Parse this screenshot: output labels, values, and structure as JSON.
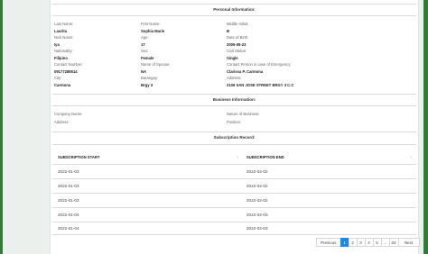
{
  "personal": {
    "title": "Personal Information:",
    "rows": [
      {
        "c1_label": "Last Name:",
        "c2_label": "First Name:",
        "c3_label": "Middle Initial:",
        "c1_value": "Laurita",
        "c2_value": "Sophia Marie",
        "c3_value": "B"
      },
      {
        "c1_label": "Nick Name:",
        "c2_label": "Age:",
        "c3_label": "Date of Birth:",
        "c1_value": "Iya",
        "c2_value": "17",
        "c3_value": "2005-05-23"
      },
      {
        "c1_label": "Nationality:",
        "c2_label": "Sex:",
        "c3_label": "Civil Status:",
        "c1_value": "Filipino",
        "c2_value": "Female",
        "c3_value": "Single"
      },
      {
        "c1_label": "Contact Number:",
        "c2_label": "Name of Spouse:",
        "c3_label": "Contact Person in case of Emergency:",
        "c1_value": "09177285514",
        "c2_value": "NA",
        "c3_value": "Clarissa P. Carmona"
      },
      {
        "c1_label": "City:",
        "c2_label": "Barangay:",
        "c3_label": "Address:",
        "c1_value": "Carmona",
        "c2_value": "Brgy 3",
        "c3_value": "2106 SAN JOSE STREET BRGY 3 C.C"
      }
    ]
  },
  "business": {
    "title": "Business Information:",
    "company_label": "Company Name:",
    "nature_label": "Nature of Business:",
    "address_label": "Address:",
    "position_label": "Position:"
  },
  "subscription": {
    "title": "Subscription Record:",
    "col_start": "SUBSCRIPTION START",
    "col_end": "SUBSCRIPTION END",
    "rows": [
      {
        "start": "2022-01-03",
        "end": "2022-02-02"
      },
      {
        "start": "2022-01-03",
        "end": "2022-02-02"
      },
      {
        "start": "2022-01-03",
        "end": "2022-02-02"
      },
      {
        "start": "2022-01-04",
        "end": "2022-02-03"
      },
      {
        "start": "2022-01-04",
        "end": "2022-02-03"
      }
    ]
  },
  "pagination": {
    "previous": "Previous",
    "pages": [
      "1",
      "2",
      "3",
      "4",
      "5",
      "...",
      "63"
    ],
    "next": "Next",
    "active": "1"
  },
  "colors": {
    "accent": "#1e88e5",
    "sidebar": "#2e7d32"
  }
}
